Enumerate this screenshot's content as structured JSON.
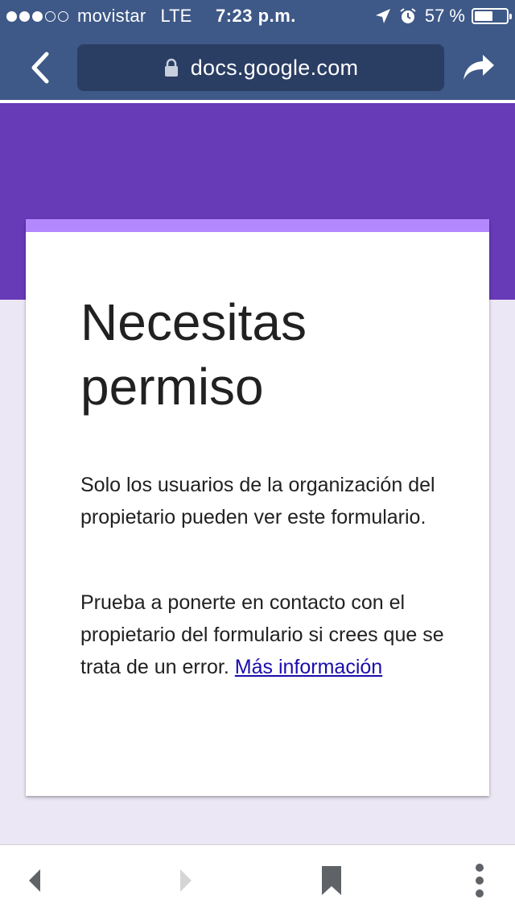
{
  "status_bar": {
    "carrier": "movistar",
    "network": "LTE",
    "time": "7:23 p.m.",
    "battery_percent": "57 %",
    "battery_level": 0.57,
    "signal_bars_filled": 3,
    "signal_bars_total": 5
  },
  "browser": {
    "url": "docs.google.com",
    "icons": [
      "back-icon",
      "lock-icon",
      "share-icon"
    ]
  },
  "card": {
    "title_line1": "Necesitas",
    "title_line2": "permiso",
    "paragraph1": "Solo los usuarios de la organización del propietario pueden ver este formulario.",
    "paragraph2": "Prueba a ponerte en contacto con el propietario del formulario si crees que se trata de un error.",
    "link_text": "Más información"
  },
  "bottom_toolbar": {
    "icons": [
      "back-icon",
      "forward-icon",
      "bookmark-icon",
      "more-icon"
    ]
  },
  "colors": {
    "chrome": "#3e5887",
    "url_bar": "#2a3d63",
    "header_purple": "#673ab7",
    "card_accent": "#b388ff",
    "page_background": "#ece7f5",
    "link": "#1a0dab"
  }
}
